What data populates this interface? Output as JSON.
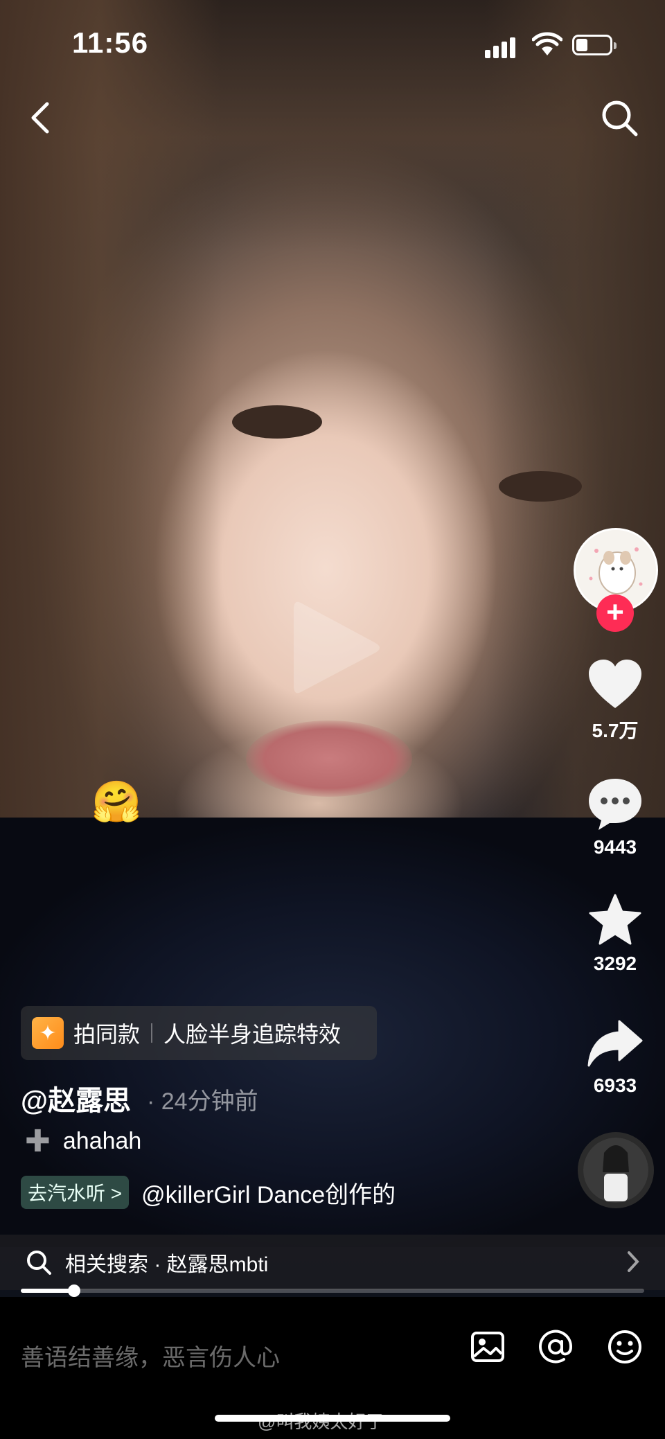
{
  "status_bar": {
    "time": "11:56",
    "battery_level": 0.35
  },
  "play_icon": "play-icon",
  "creator": {
    "avatar_icon": "cartoon-dog-avatar",
    "follow_label": "+"
  },
  "actions": {
    "likes": "5.7万",
    "comments": "9443",
    "favorites": "3292",
    "shares": "6933"
  },
  "emoji": "🤗",
  "effect": {
    "label": "拍同款",
    "name": "人脸半身追踪特效"
  },
  "post": {
    "author": "@赵露思",
    "time_ago": "· 24分钟前",
    "description": "ahahah"
  },
  "music": {
    "app_link": "去汽水听 >",
    "track": "@killerGirl Dance创作的"
  },
  "related_search": {
    "label": "相关搜索 · 赵露思mbti"
  },
  "progress": {
    "fraction": 0.085
  },
  "comment_bar": {
    "placeholder": "善语结善缘，恶言伤人心"
  },
  "watermark": "@叫我姨太好了",
  "colors": {
    "accent": "#fe2c55",
    "soda": "#2e4a44"
  }
}
